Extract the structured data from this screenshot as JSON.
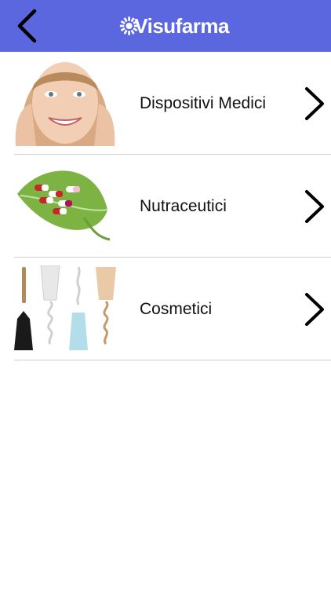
{
  "header": {
    "background": "#5b67df",
    "back_icon": "chevron-left-icon",
    "logo_text": "Visufarma"
  },
  "categories": [
    {
      "label": "Dispositivi Medici",
      "image": "smiling-woman-face-photo",
      "icon": "chevron-right-icon"
    },
    {
      "label": "Nutraceutici",
      "image": "green-leaf-with-capsules-photo",
      "icon": "chevron-right-icon"
    },
    {
      "label": "Cosmetici",
      "image": "cosmetic-tubes-photo",
      "icon": "chevron-right-icon"
    }
  ]
}
